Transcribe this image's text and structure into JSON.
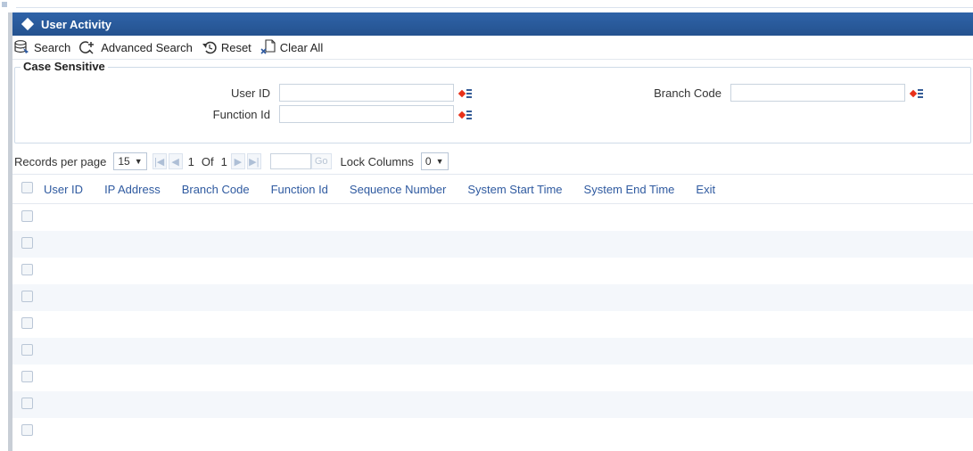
{
  "window": {
    "title": "User Activity"
  },
  "toolbar": {
    "search": "Search",
    "advanced_search": "Advanced Search",
    "reset": "Reset",
    "clear_all": "Clear All"
  },
  "criteria": {
    "legend": "Case Sensitive",
    "user_id_label": "User ID",
    "user_id_value": "",
    "function_id_label": "Function Id",
    "function_id_value": "",
    "branch_code_label": "Branch Code",
    "branch_code_value": ""
  },
  "pager": {
    "records_label": "Records per page",
    "records_value": "15",
    "page_current": "1",
    "of_label": "Of",
    "page_total": "1",
    "go_label": "Go",
    "lock_label": "Lock Columns",
    "lock_value": "0"
  },
  "grid": {
    "columns": [
      "User ID",
      "IP Address",
      "Branch Code",
      "Function Id",
      "Sequence Number",
      "System Start Time",
      "System End Time",
      "Exit"
    ],
    "row_count": 9
  },
  "colors": {
    "title_bar": "#2f63a8",
    "header_text": "#2f5aa0",
    "row_alt": "#f4f7fb"
  }
}
